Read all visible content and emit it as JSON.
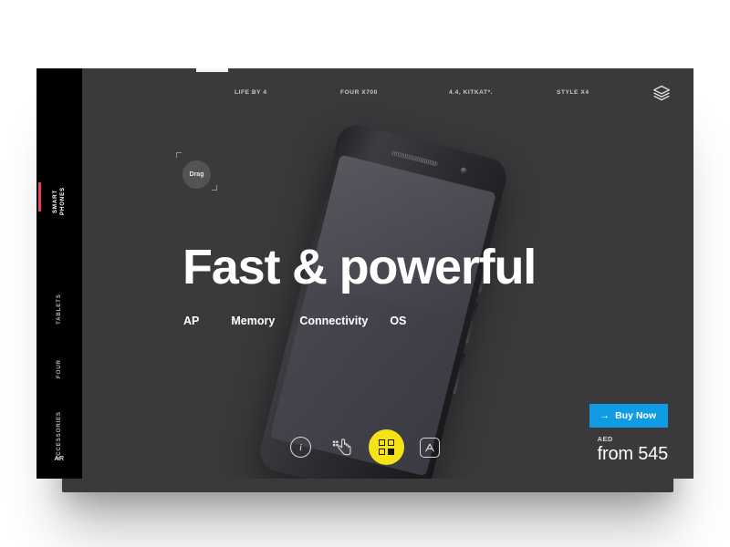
{
  "colors": {
    "card_bg": "#3a3a3c",
    "sidebar_bg": "#000000",
    "accent_red": "#e8425c",
    "accent_yellow": "#f5e316",
    "accent_blue": "#109ce2",
    "page_bg": "#ffffff"
  },
  "sidebar": {
    "items": [
      {
        "label": "SMART\nPHONES",
        "active": true
      },
      {
        "label": "TABLETS",
        "active": false
      },
      {
        "label": "FOUR",
        "active": false
      },
      {
        "label": "ACCESSORIES",
        "active": false
      }
    ],
    "bottom_label": "AR"
  },
  "topnav": {
    "items": [
      {
        "label": "LIFE BY 4"
      },
      {
        "label": "FOUR X700"
      },
      {
        "label": "4.4, KITKAT*."
      },
      {
        "label": "STYLE X4"
      }
    ],
    "layers_icon": "layers-icon"
  },
  "drag": {
    "label": "Drag"
  },
  "hero": {
    "title": "Fast & powerful",
    "subnav": [
      {
        "label": "AP"
      },
      {
        "label": "Memory"
      },
      {
        "label": "Connectivity"
      },
      {
        "label": "OS"
      }
    ]
  },
  "iconbar": {
    "items": [
      {
        "name": "info-icon",
        "glyph": "i"
      },
      {
        "name": "touch-gesture-icon",
        "glyph": ""
      },
      {
        "name": "grid-apps-icon",
        "glyph": ""
      },
      {
        "name": "app-store-icon",
        "glyph": ""
      }
    ]
  },
  "buy": {
    "arrow": "→",
    "label": "Buy Now",
    "currency": "AED",
    "price": "from 545"
  }
}
